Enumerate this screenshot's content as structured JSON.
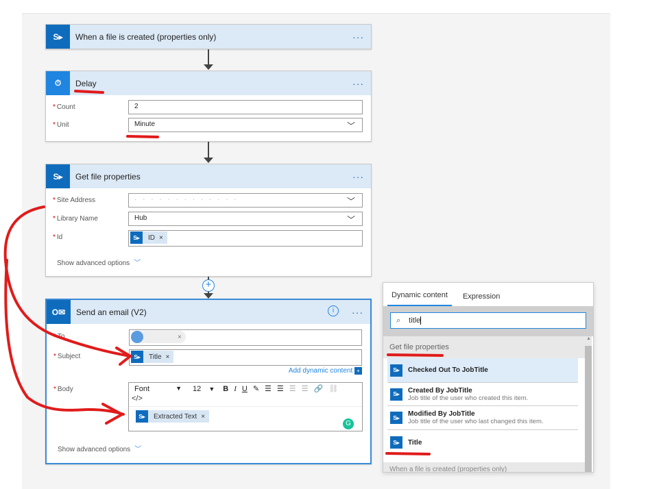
{
  "trigger": {
    "title": "When a file is created (properties only)"
  },
  "delay": {
    "title": "Delay",
    "count_label": "Count",
    "count_value": "2",
    "unit_label": "Unit",
    "unit_value": "Minute"
  },
  "getfile": {
    "title": "Get file properties",
    "site_label": "Site Address",
    "site_value": "",
    "library_label": "Library Name",
    "library_value": "Hub",
    "id_label": "Id",
    "id_token": "ID",
    "advanced": "Show advanced options"
  },
  "email": {
    "title": "Send an email (V2)",
    "to_label": "To",
    "subject_label": "Subject",
    "subject_token": "Title",
    "add_dynamic": "Add dynamic content",
    "body_label": "Body",
    "font": "Font",
    "size": "12",
    "code": "</>",
    "body_token": "Extracted Text",
    "advanced": "Show advanced options"
  },
  "panel": {
    "tabs": [
      "Dynamic content",
      "Expression"
    ],
    "search_value": "title",
    "group": "Get file properties",
    "items": [
      {
        "title": "Checked Out To JobTitle",
        "desc": ""
      },
      {
        "title": "Created By JobTitle",
        "desc": "Job title of the user who created this item."
      },
      {
        "title": "Modified By JobTitle",
        "desc": "Job title of the user who last changed this item."
      },
      {
        "title": "Title",
        "desc": ""
      }
    ],
    "next_group": "When a file is created (properties only)"
  },
  "colors": {
    "accent": "#0f6cbd",
    "annotation": "#e01b1b"
  }
}
